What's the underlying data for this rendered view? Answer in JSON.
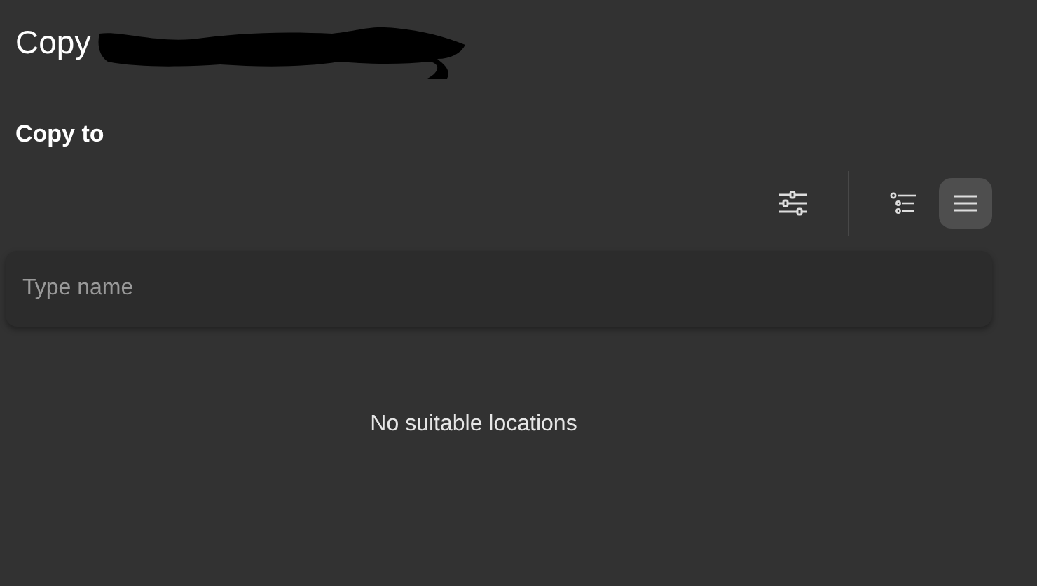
{
  "window": {
    "title": "Copy"
  },
  "heading": "Copy to",
  "view_modes": [
    {
      "kind": "outline",
      "selected": false
    },
    {
      "kind": "list",
      "selected": true
    }
  ],
  "search": {
    "placeholder": "Type name"
  },
  "empty_message": "No suitable locations"
}
